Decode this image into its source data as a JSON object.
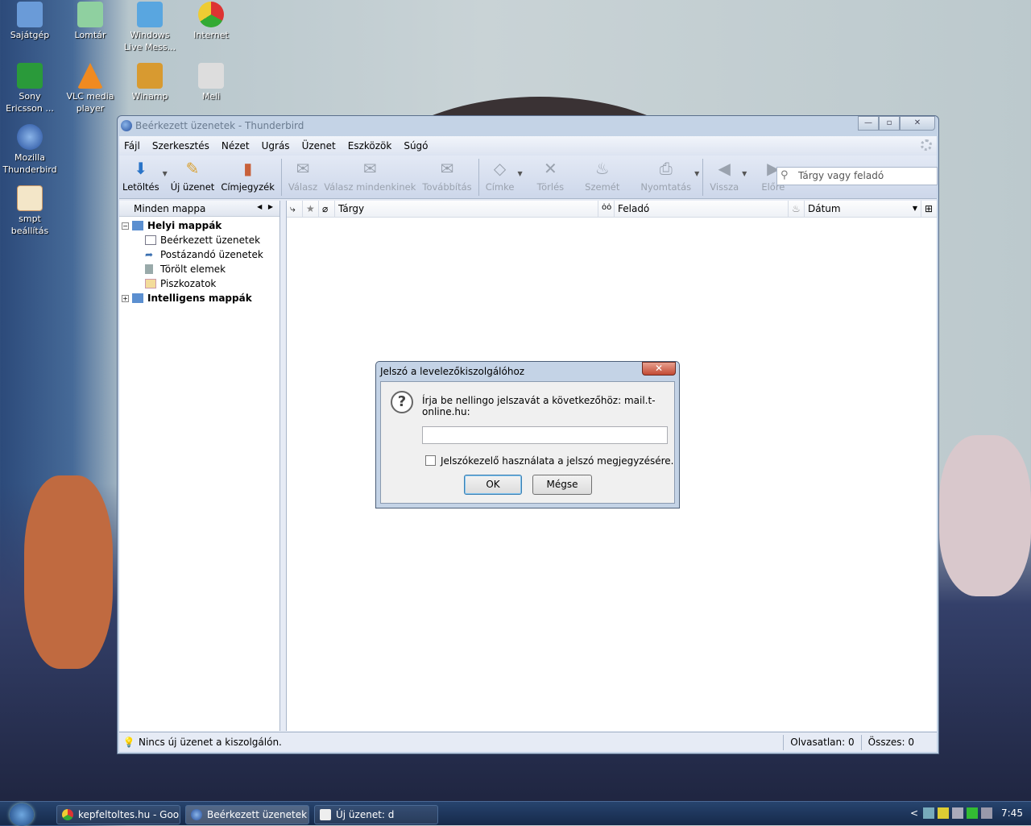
{
  "desktop_icons": [
    {
      "label": "Sajátgép",
      "icon": "computer-icon"
    },
    {
      "label": "Lomtár",
      "icon": "recycle-bin-icon"
    },
    {
      "label": "Windows Live Mess...",
      "icon": "messenger-icon"
    },
    {
      "label": "Internet",
      "icon": "chrome-icon"
    },
    {
      "label": "Sony Ericsson ...",
      "icon": "sony-ericsson-icon"
    },
    {
      "label": "VLC media player",
      "icon": "vlc-icon"
    },
    {
      "label": "Winamp",
      "icon": "winamp-icon"
    },
    {
      "label": "Meli",
      "icon": "drive-icon"
    },
    {
      "label": "Mozilla Thunderbird",
      "icon": "thunderbird-icon"
    },
    {
      "label": "smpt beállítás",
      "icon": "document-icon"
    }
  ],
  "window": {
    "title": "Beérkezett üzenetek - Thunderbird"
  },
  "menu": [
    "Fájl",
    "Szerkesztés",
    "Nézet",
    "Ugrás",
    "Üzenet",
    "Eszközök",
    "Súgó"
  ],
  "toolbar": {
    "get": "Letöltés",
    "write": "Új üzenet",
    "address": "Címjegyzék",
    "reply": "Válasz",
    "reply_all": "Válasz mindenkinek",
    "forward": "Továbbítás",
    "tag": "Címke",
    "delete": "Törlés",
    "junk": "Szemét",
    "print": "Nyomtatás",
    "back": "Vissza",
    "forward_nav": "Előre",
    "search_placeholder": "Tárgy vagy feladó"
  },
  "folder_pane": {
    "header": "Minden mappa",
    "accounts": [
      {
        "name": "Helyi mappák",
        "folders": [
          "Beérkezett üzenetek",
          "Postázandó üzenetek",
          "Törölt elemek",
          "Piszkozatok"
        ]
      },
      {
        "name": "Intelligens mappák"
      }
    ]
  },
  "columns": {
    "subject": "Tárgy",
    "sender": "Feladó",
    "date": "Dátum"
  },
  "status": {
    "message": "Nincs új üzenet a kiszolgálón.",
    "unread": "Olvasatlan: 0",
    "total": "Összes: 0"
  },
  "dialog": {
    "title": "Jelszó a levelezőkiszolgálóhoz",
    "prompt": "Írja be nellingo jelszavát a következőhöz: mail.t-online.hu:",
    "password_value": "",
    "checkbox_label": "Jelszókezelő használata a jelszó megjegyzésére.",
    "checkbox_checked": false,
    "ok": "OK",
    "cancel": "Mégse"
  },
  "taskbar": {
    "tasks": [
      "kepfeltoltes.hu - Goo...",
      "Beérkezett üzenetek ...",
      "Új üzenet: d"
    ],
    "clock": "7:45",
    "tray_arrow": "<"
  }
}
